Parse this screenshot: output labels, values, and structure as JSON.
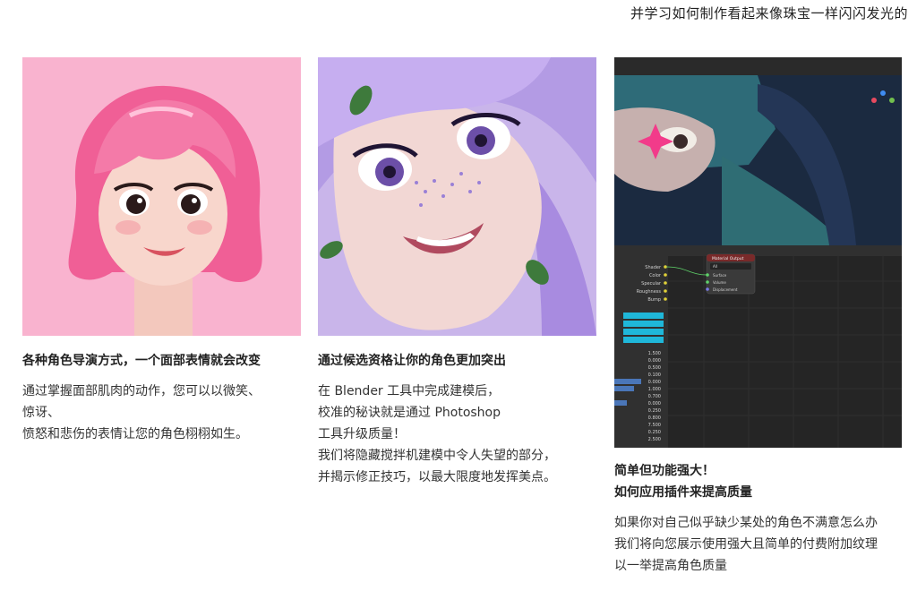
{
  "header": {
    "text": "并学习如何制作看起来像珠宝一样闪闪发光的"
  },
  "cards": [
    {
      "image_alt": "pink-haired character head render",
      "title": "各种角色导演方式，一个面部表情就会改变",
      "description": "通过掌握面部肌肉的动作，您可以以微笑、\n惊讶、\n愤怒和悲伤的表情让您的角色栩栩如生。"
    },
    {
      "image_alt": "purple-haired character close-up render",
      "title": "通过候选资格让你的角色更加突出",
      "description": "在 Blender 工具中完成建模后，\n校准的秘诀就是通过 Photoshop\n工具升级质量！\n我们将隐藏搅拌机建模中令人失望的部分，\n并揭示修正技巧，以最大限度地发挥美点。"
    },
    {
      "image_alt": "Blender material node editor screenshot",
      "title_line1": "简单但功能强大！",
      "title_line2": "如何应用插件来提高质量",
      "description": "如果你对自己似乎缺少某处的角色不满意怎么办\n我们将向您展示使用强大且简单的付费附加纹理\n以一举提高角色质量"
    }
  ],
  "blender_ui": {
    "node_header": "Material Output",
    "node_dropdown": "All",
    "node_inputs": [
      "Surface",
      "Volume",
      "Displacement"
    ],
    "bsdf_outputs": [
      "Shader",
      "Color",
      "Specular",
      "Roughness",
      "Bump"
    ],
    "param_values": [
      "1.500",
      "0.000",
      "0.500",
      "0.100",
      "0.000",
      "1.000",
      "0.700",
      "0.000",
      "0.250",
      "0.800",
      "7.500",
      "0.250",
      "2.500"
    ]
  }
}
